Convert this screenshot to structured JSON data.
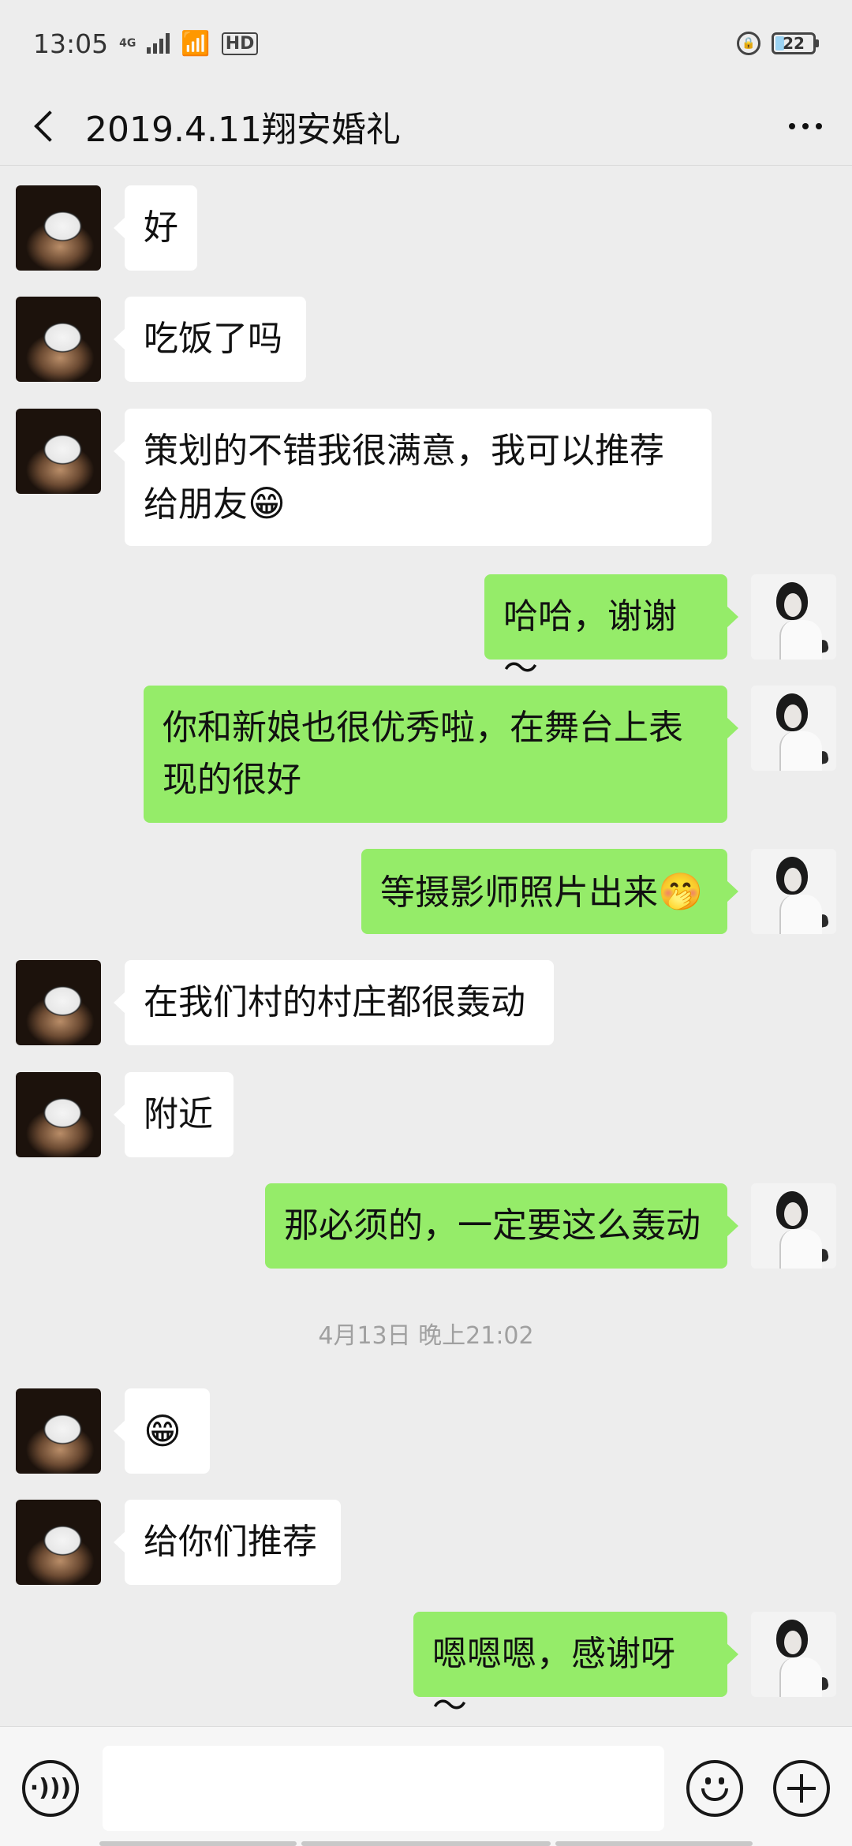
{
  "status_bar": {
    "time": "13:05",
    "network": "4G",
    "hd_label": "HD",
    "battery_level": "22",
    "battery_fraction": 0.22
  },
  "header": {
    "title": "2019.4.11翔安婚礼"
  },
  "messages": [
    {
      "side": "left",
      "text": "好"
    },
    {
      "side": "left",
      "text": "吃饭了吗"
    },
    {
      "side": "left",
      "text": "策划的不错我很满意，我可以推荐给朋友",
      "emoji": "😁"
    },
    {
      "side": "right",
      "text": "哈哈，谢谢～"
    },
    {
      "side": "right",
      "text": "你和新娘也很优秀啦，在舞台上表现的很好"
    },
    {
      "side": "right",
      "text": "等摄影师照片出来",
      "emoji": "🤭"
    },
    {
      "side": "left",
      "text": "在我们村的村庄都很轰动"
    },
    {
      "side": "left",
      "text": "附近"
    },
    {
      "side": "right",
      "text": "那必须的，一定要这么轰动"
    },
    {
      "side": "left",
      "text": "",
      "emoji": "😁"
    },
    {
      "side": "left",
      "text": "给你们推荐"
    },
    {
      "side": "right",
      "text": "嗯嗯嗯，感谢呀～"
    }
  ],
  "timestamp": "4月13日 晚上21:02",
  "input": {
    "value": ""
  },
  "colors": {
    "background": "#ededed",
    "bubble_mine": "#95ec69",
    "bubble_theirs": "#ffffff"
  }
}
